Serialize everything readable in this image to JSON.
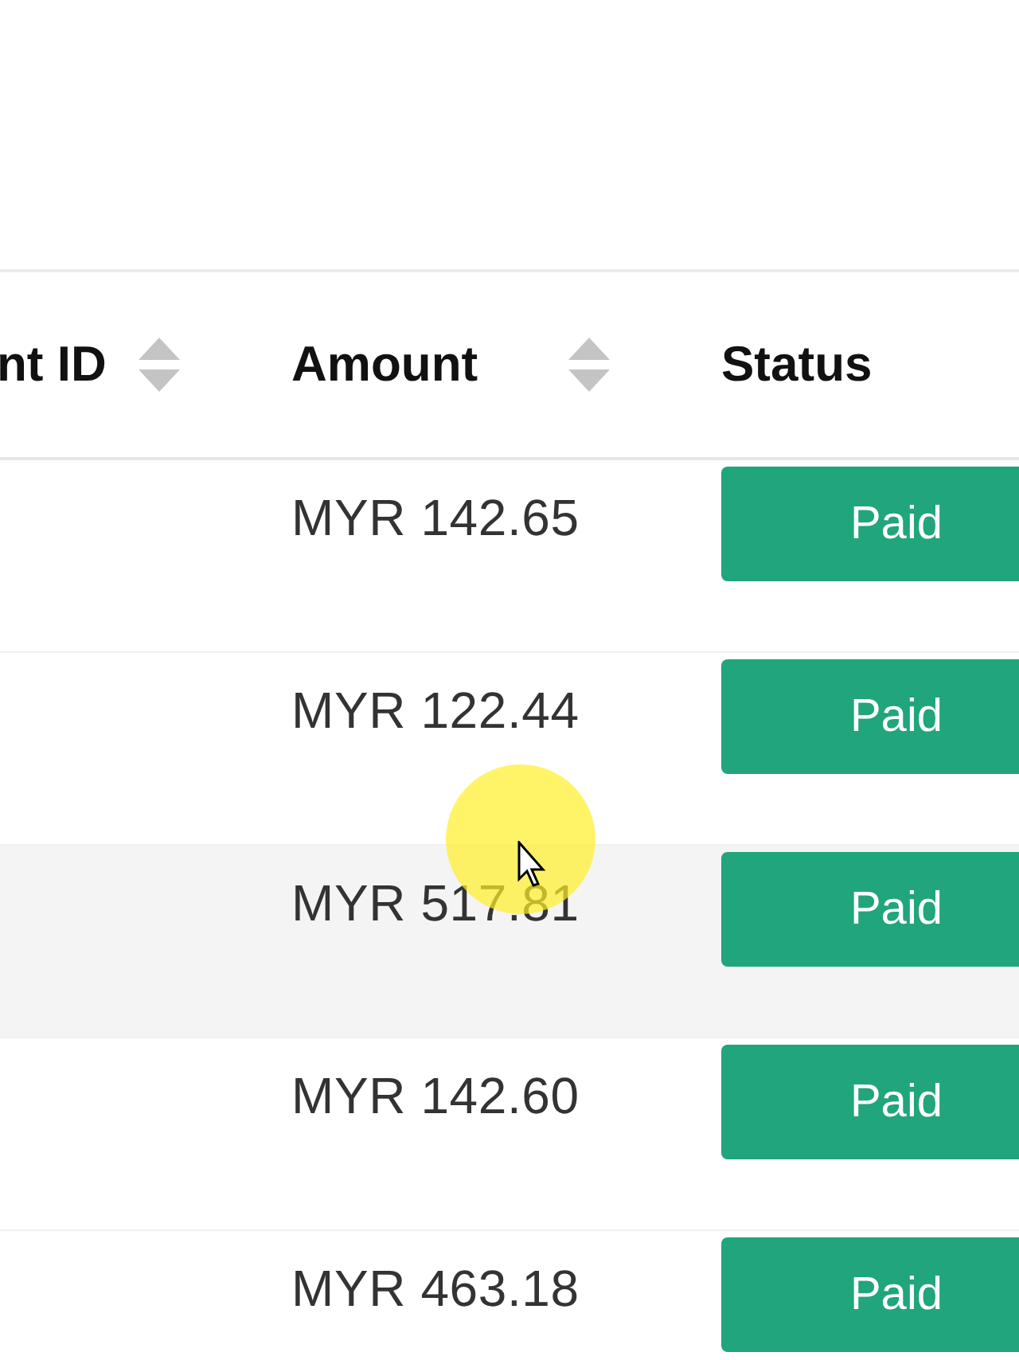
{
  "table": {
    "columns": [
      {
        "label": "nt ID",
        "sortable": true
      },
      {
        "label": "Amount",
        "sortable": true
      },
      {
        "label": "Status",
        "sortable": false
      }
    ],
    "rows": [
      {
        "amount": "MYR 142.65",
        "status": "Paid",
        "hovered": false
      },
      {
        "amount": "MYR 122.44",
        "status": "Paid",
        "hovered": false
      },
      {
        "amount": "MYR 517.81",
        "status": "Paid",
        "hovered": true
      },
      {
        "amount": "MYR 142.60",
        "status": "Paid",
        "hovered": false
      },
      {
        "amount": "MYR 463.18",
        "status": "Paid",
        "hovered": false
      }
    ]
  }
}
